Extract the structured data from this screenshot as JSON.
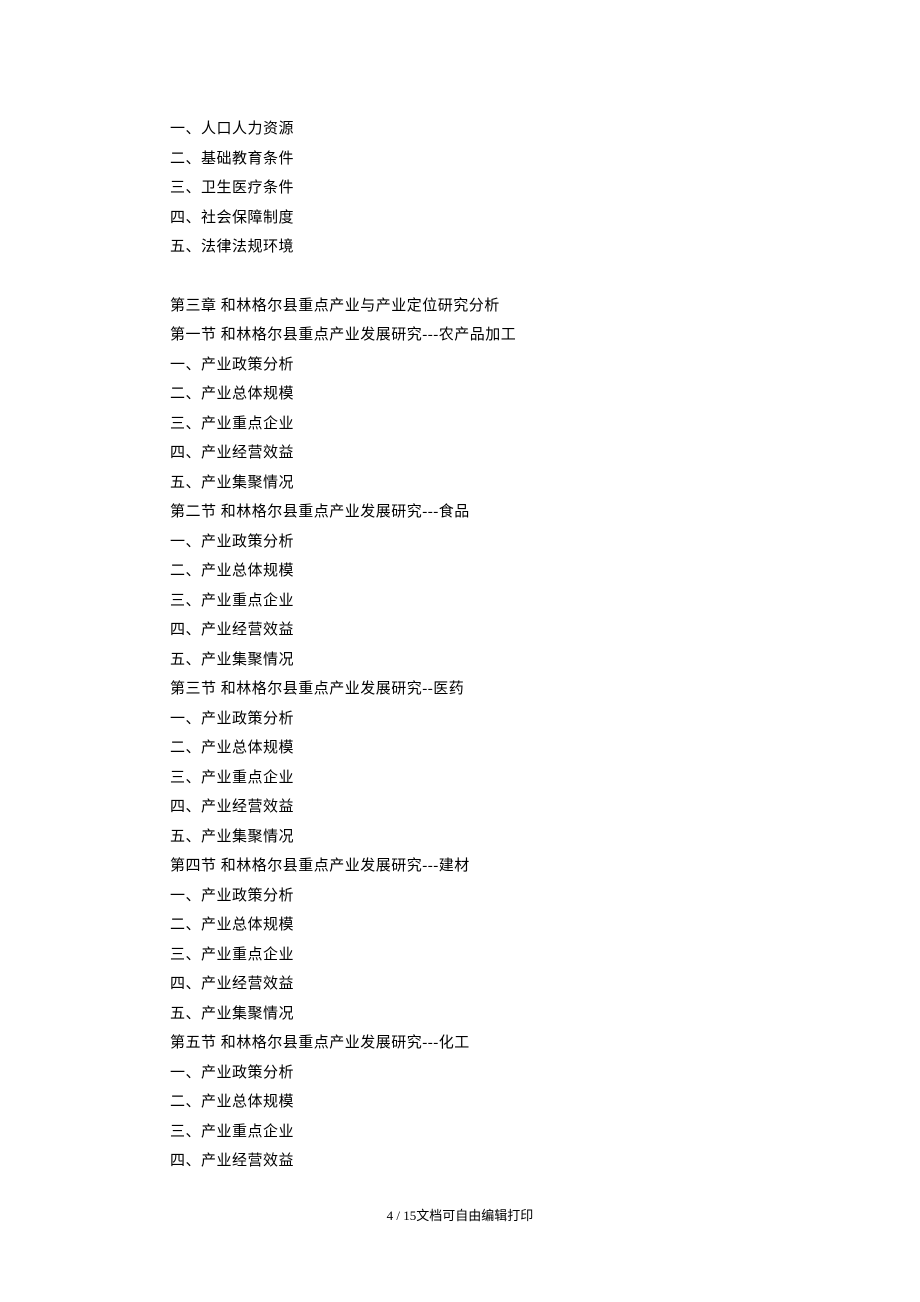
{
  "lines": [
    "一、人口人力资源",
    "二、基础教育条件",
    "三、卫生医疗条件",
    "四、社会保障制度",
    "五、法律法规环境",
    "",
    "第三章  和林格尔县重点产业与产业定位研究分析",
    "第一节  和林格尔县重点产业发展研究---农产品加工",
    "一、产业政策分析",
    "二、产业总体规模",
    "三、产业重点企业",
    "四、产业经营效益",
    "五、产业集聚情况",
    "第二节  和林格尔县重点产业发展研究---食品",
    "一、产业政策分析",
    "二、产业总体规模",
    "三、产业重点企业",
    "四、产业经营效益",
    "五、产业集聚情况",
    "第三节  和林格尔县重点产业发展研究--医药",
    "一、产业政策分析",
    "二、产业总体规模",
    "三、产业重点企业",
    "四、产业经营效益",
    "五、产业集聚情况",
    "第四节  和林格尔县重点产业发展研究---建材",
    "一、产业政策分析",
    "二、产业总体规模",
    "三、产业重点企业",
    "四、产业经营效益",
    "五、产业集聚情况",
    "第五节  和林格尔县重点产业发展研究---化工",
    "一、产业政策分析",
    "二、产业总体规模",
    "三、产业重点企业",
    "四、产业经营效益"
  ],
  "footer": {
    "page_current": "4",
    "page_total": "15",
    "note": "文档可自由编辑打印"
  }
}
